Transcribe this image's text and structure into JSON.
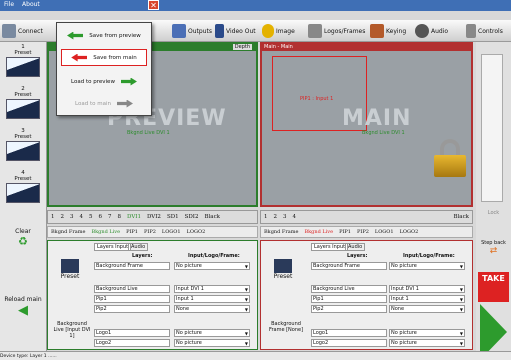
{
  "menu": {
    "file": "File",
    "about": "About"
  },
  "toolbar": {
    "connect": "Connect",
    "outputs": "Outputs",
    "videoout": "Video Out",
    "image": "Image",
    "logos": "Logos/Frames",
    "keying": "Keying",
    "audio": "Audio",
    "controls": "Controls"
  },
  "popup": {
    "save_preview": "Save from preview",
    "save_main": "Save from main",
    "load_preview": "Load to preview",
    "load_main": "Load to main"
  },
  "presets": [
    "1\nPreset",
    "2\nPreset",
    "3\nPreset",
    "4\nPreset"
  ],
  "preview": {
    "big": "PREVIEW",
    "depth": "Depth",
    "bkgnd": "Bkgnd Live DVI 1"
  },
  "main": {
    "header": "Main - Main",
    "big": "MAIN",
    "pip": "PIP1 : Input 1",
    "bkgnd": "Bkgnd Live DVI 1"
  },
  "numbers_left": [
    "1",
    "2",
    "3",
    "4",
    "5",
    "6",
    "7",
    "8",
    "DVI1",
    "DVI2",
    "SD1",
    "SDI2",
    "Black"
  ],
  "numbers_right": [
    "1",
    "2",
    "3",
    "4",
    "Black"
  ],
  "layers_left": [
    "Bkgnd Frame",
    "Bkgnd Live",
    "PIP1",
    "PIP2",
    "LOGO1",
    "LOGO2"
  ],
  "layers_right": [
    "Bkgnd Frame",
    "Bkgnd Live",
    "PIP1",
    "PIP2",
    "LOGO1",
    "LOGO2"
  ],
  "side": {
    "clear": "Clear",
    "reload": "Reload main",
    "lock": "Lock",
    "stepback": "Step back",
    "take": "TAKE"
  },
  "tabs": {
    "layers": "Layers Input",
    "audio": "Audio"
  },
  "table": {
    "h1": "Layers:",
    "h2": "Input/Logo/Frame:",
    "rows": [
      [
        "Background Frame",
        "No picture"
      ],
      [
        "Background Live",
        "Input DVI 1"
      ],
      [
        "Pip1",
        "Input 1"
      ],
      [
        "Pip2",
        "None"
      ],
      [
        "Logo1",
        "No picture"
      ],
      [
        "Logo2",
        "No picture"
      ]
    ]
  },
  "preset_label": "Preset",
  "bg_live_left": "Background Live [Input DVI 1]",
  "bg_frame_right": "Background Frame [None]",
  "status": "Device type: Layer 1 ......"
}
